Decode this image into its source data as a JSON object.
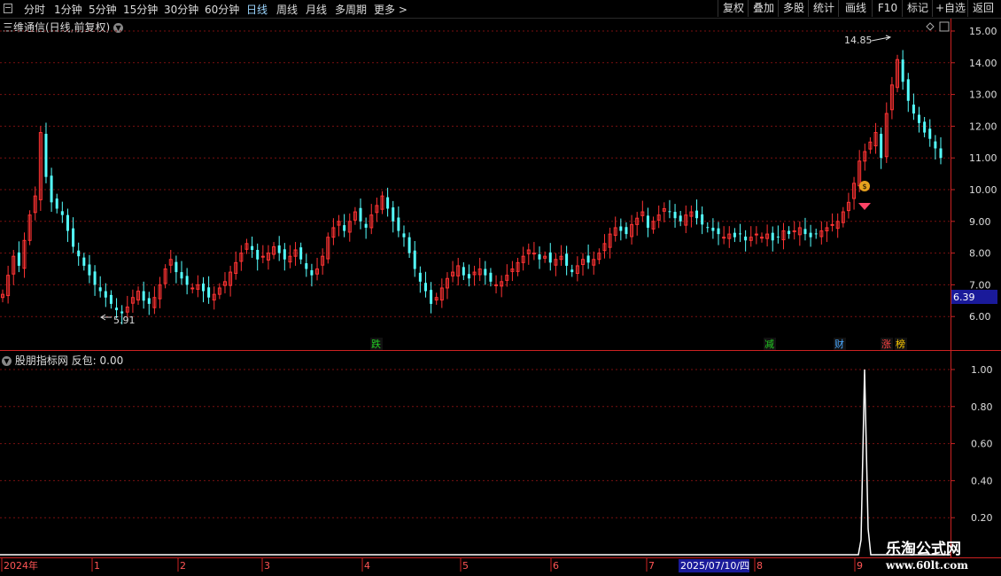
{
  "toolbar": {
    "periods": [
      "分时",
      "1分钟",
      "5分钟",
      "15分钟",
      "30分钟",
      "60分钟",
      "日线",
      "周线",
      "月线",
      "多周期",
      "更多 >"
    ],
    "active_period": "日线",
    "buttons": [
      "复权",
      "叠加",
      "多股",
      "统计",
      "画线",
      "F10",
      "标记",
      "+自选",
      "返回"
    ]
  },
  "main_chart": {
    "title": "三维通信(日线,前复权)",
    "y_ticks": [
      "15.00",
      "14.00",
      "13.00",
      "12.00",
      "11.00",
      "10.00",
      "9.00",
      "8.00",
      "7.00",
      "6.00"
    ],
    "current_price": "6.39",
    "high_label": "14.85",
    "low_label": "5.91",
    "markers": [
      {
        "text": "跌",
        "color": "#22cc22"
      },
      {
        "text": "减",
        "color": "#22cc22"
      },
      {
        "text": "财",
        "color": "#4aa8ff"
      },
      {
        "text": "涨",
        "color": "#ff4444"
      },
      {
        "text": "榜",
        "color": "#ffcc00"
      }
    ],
    "colors": {
      "up": "#ff3333",
      "down": "#54ffff",
      "grid": "#7a1010",
      "axis": "#cc2222"
    },
    "icons": [
      "money-bag-icon",
      "diamond-icon"
    ]
  },
  "indicator": {
    "title": "股朋指标网 反包: 0.00",
    "y_ticks": [
      "1.00",
      "0.80",
      "0.60",
      "0.40",
      "0.20"
    ],
    "line_color": "#ffffff"
  },
  "date_axis": {
    "labels": [
      "2024年",
      "1",
      "2",
      "3",
      "4",
      "5",
      "6",
      "7",
      "8",
      "9"
    ],
    "highlight_date": "2025/07/10/四"
  },
  "watermark": {
    "line1": "乐淘公式网",
    "line2": "www.60lt.com"
  }
}
